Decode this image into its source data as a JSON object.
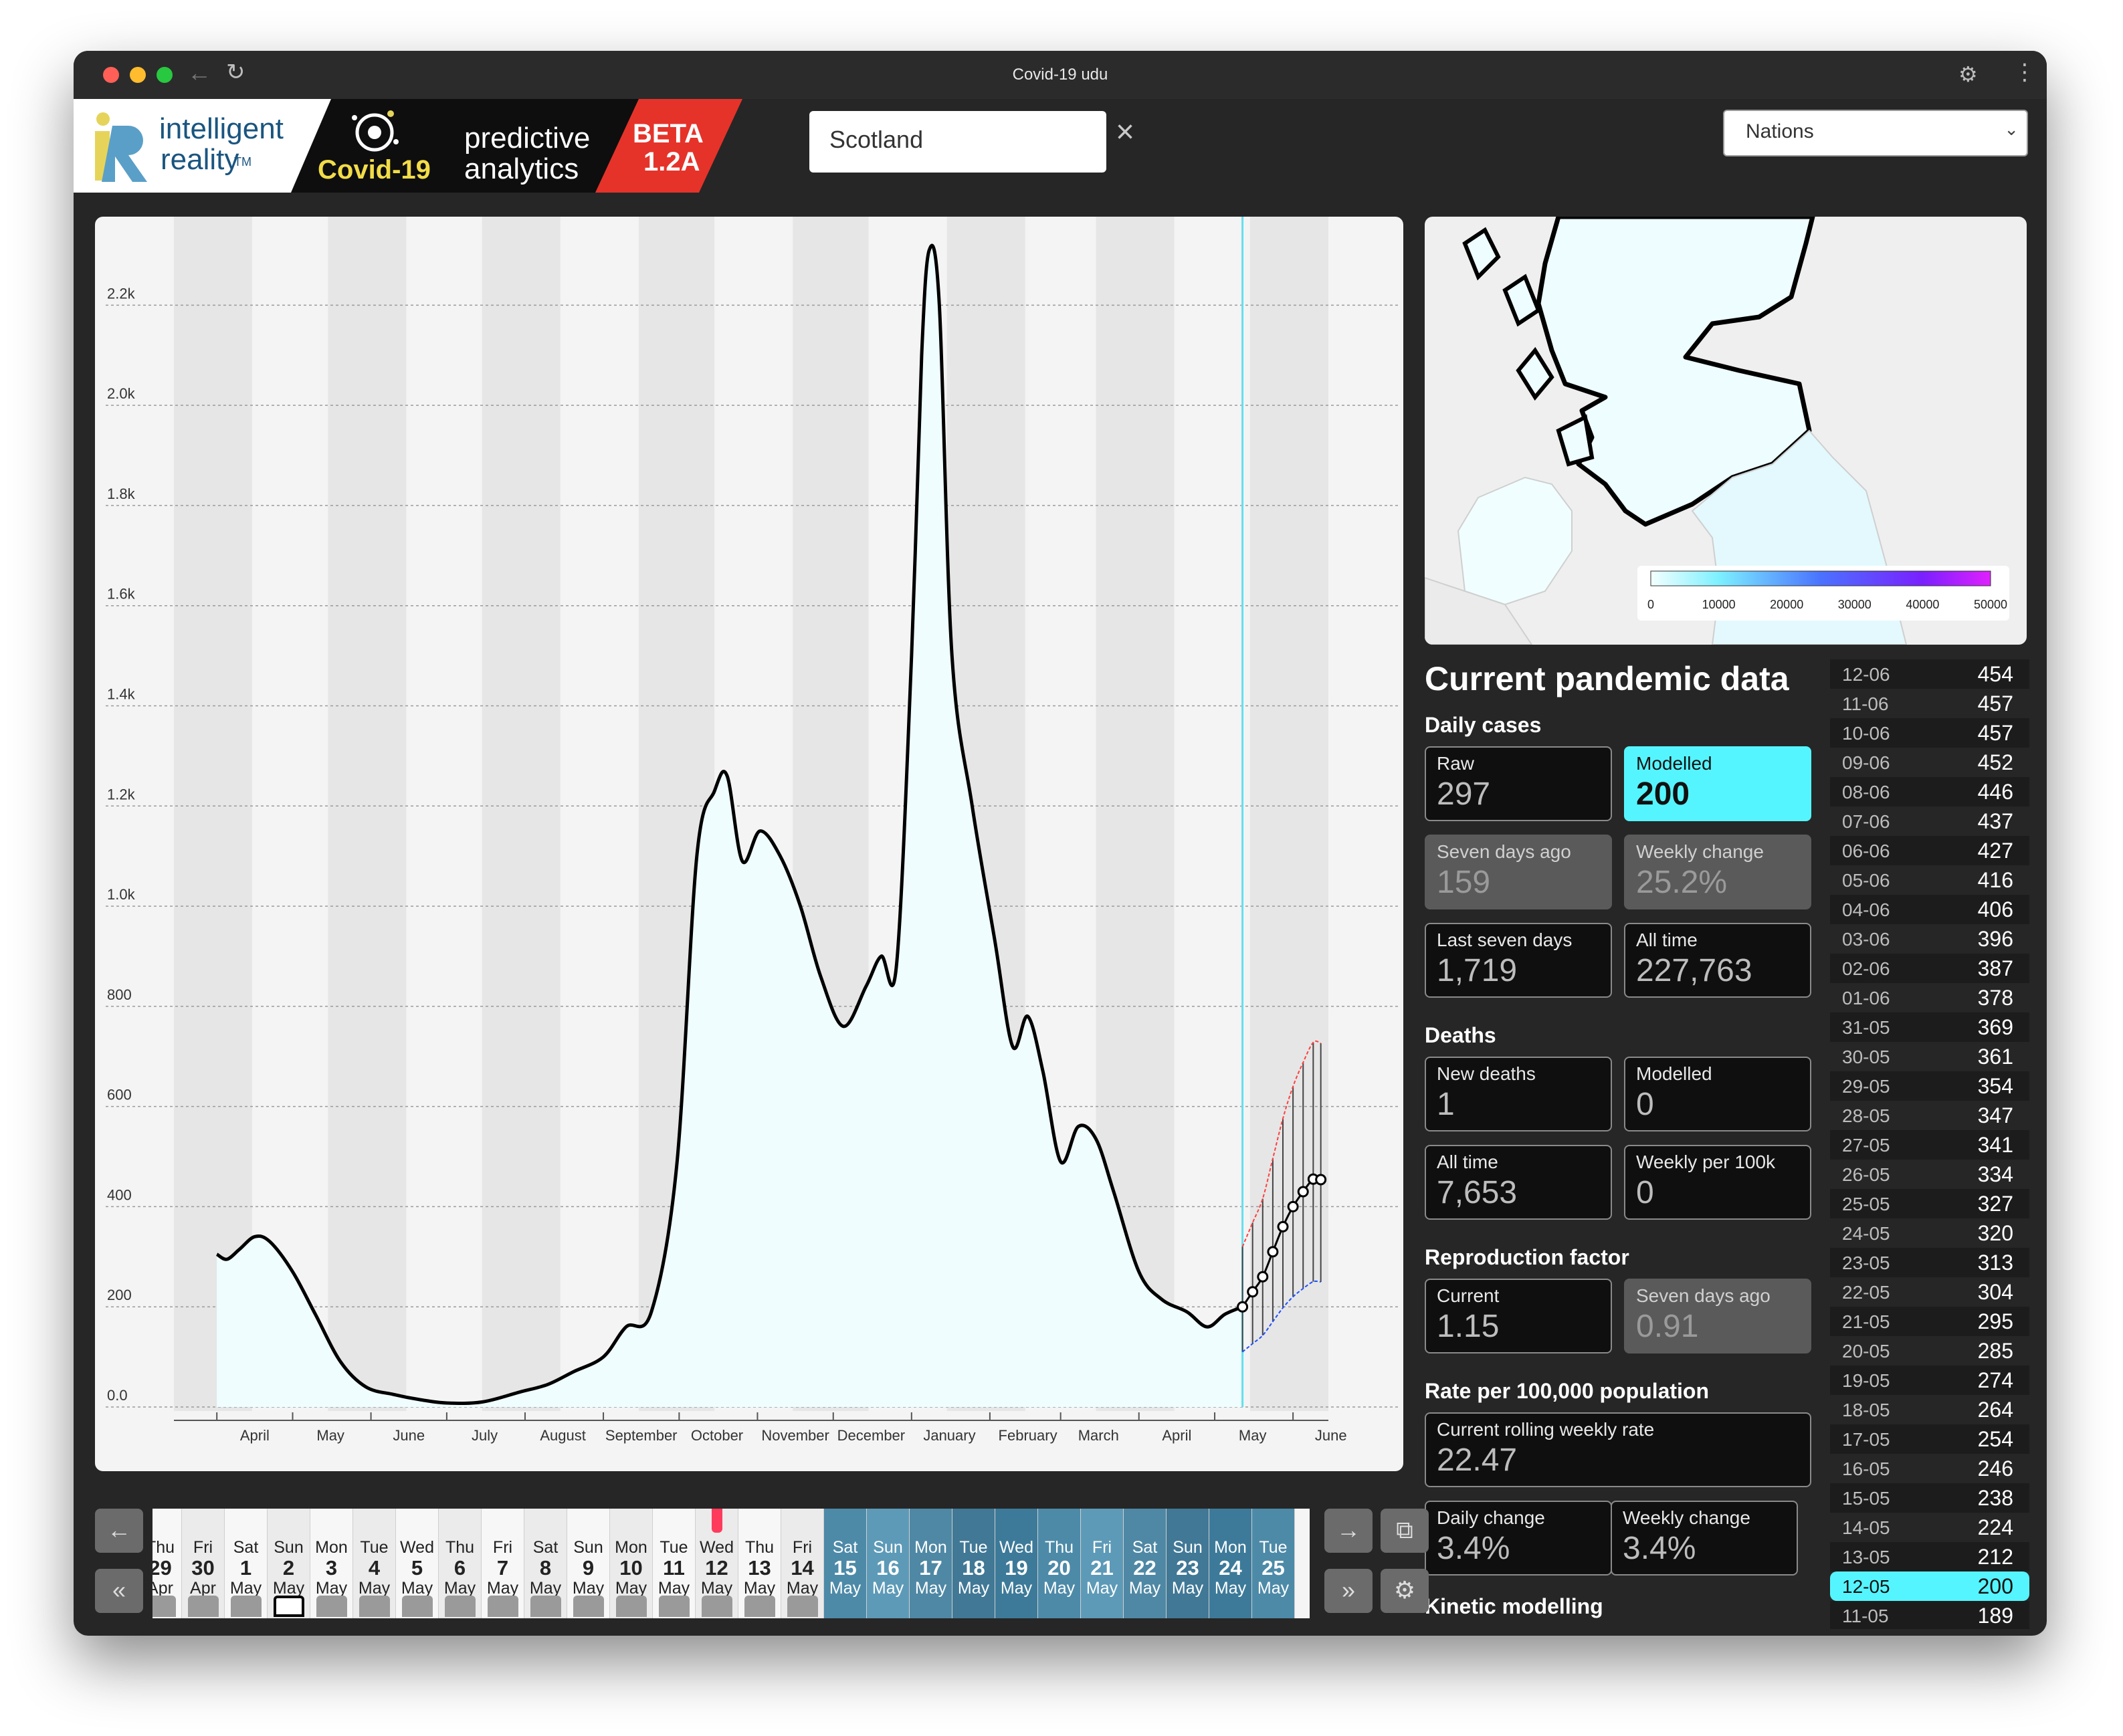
{
  "window": {
    "title": "Covid-19 udu"
  },
  "brand": {
    "company_line1": "intelligent",
    "company_line2": "reality",
    "company_tm": "TM",
    "product": "Covid-19",
    "tag_line1": "predictive",
    "tag_line2": "analytics",
    "badge_line1": "BETA",
    "badge_line2": "1.2A"
  },
  "search": {
    "value": "Scotland"
  },
  "region_select": {
    "selected": "Nations"
  },
  "map": {
    "legend_ticks": [
      "0",
      "10000",
      "20000",
      "30000",
      "40000",
      "50000"
    ]
  },
  "chart_data": {
    "type": "area",
    "title": "",
    "xlabel": "",
    "ylabel": "",
    "yticks": [
      "0.0",
      "200",
      "400",
      "600",
      "800",
      "1.0k",
      "1.2k",
      "1.4k",
      "1.6k",
      "1.8k",
      "2.0k",
      "2.2k"
    ],
    "ylim": [
      0,
      2350
    ],
    "xticks": [
      "April",
      "May",
      "June",
      "July",
      "August",
      "September",
      "October",
      "November",
      "December",
      "January",
      "February",
      "March",
      "April",
      "May",
      "June"
    ],
    "xlim": [
      "2020-03-15",
      "2021-06-15"
    ],
    "series": [
      {
        "values": [
          [
            "2020-04-01",
            305
          ],
          [
            "2020-04-05",
            295
          ],
          [
            "2020-04-10",
            315
          ],
          [
            "2020-04-16",
            340
          ],
          [
            "2020-04-22",
            330
          ],
          [
            "2020-05-01",
            270
          ],
          [
            "2020-05-10",
            185
          ],
          [
            "2020-05-20",
            90
          ],
          [
            "2020-05-30",
            40
          ],
          [
            "2020-06-10",
            25
          ],
          [
            "2020-06-20",
            15
          ],
          [
            "2020-07-01",
            8
          ],
          [
            "2020-07-15",
            10
          ],
          [
            "2020-07-30",
            30
          ],
          [
            "2020-08-10",
            45
          ],
          [
            "2020-08-20",
            70
          ],
          [
            "2020-09-01",
            100
          ],
          [
            "2020-09-10",
            160
          ],
          [
            "2020-09-20",
            190
          ],
          [
            "2020-09-30",
            480
          ],
          [
            "2020-10-08",
            1100
          ],
          [
            "2020-10-15",
            1230
          ],
          [
            "2020-10-20",
            1260
          ],
          [
            "2020-10-26",
            1090
          ],
          [
            "2020-11-02",
            1150
          ],
          [
            "2020-11-10",
            1100
          ],
          [
            "2020-11-18",
            1000
          ],
          [
            "2020-11-26",
            860
          ],
          [
            "2020-12-05",
            760
          ],
          [
            "2020-12-14",
            840
          ],
          [
            "2020-12-20",
            900
          ],
          [
            "2020-12-26",
            880
          ],
          [
            "2021-01-01",
            1500
          ],
          [
            "2021-01-05",
            2100
          ],
          [
            "2021-01-08",
            2310
          ],
          [
            "2021-01-12",
            2200
          ],
          [
            "2021-01-17",
            1500
          ],
          [
            "2021-01-25",
            1200
          ],
          [
            "2021-02-03",
            930
          ],
          [
            "2021-02-10",
            720
          ],
          [
            "2021-02-16",
            780
          ],
          [
            "2021-02-22",
            670
          ],
          [
            "2021-03-01",
            490
          ],
          [
            "2021-03-08",
            560
          ],
          [
            "2021-03-15",
            535
          ],
          [
            "2021-03-22",
            430
          ],
          [
            "2021-04-01",
            270
          ],
          [
            "2021-04-10",
            215
          ],
          [
            "2021-04-20",
            190
          ],
          [
            "2021-04-28",
            160
          ],
          [
            "2021-05-05",
            185
          ],
          [
            "2021-05-12",
            200
          ]
        ]
      },
      {
        "name": "projection",
        "values": [
          [
            "2021-05-12",
            200
          ],
          [
            "2021-05-16",
            230
          ],
          [
            "2021-05-20",
            260
          ],
          [
            "2021-05-24",
            310
          ],
          [
            "2021-05-28",
            360
          ],
          [
            "2021-06-01",
            400
          ],
          [
            "2021-06-05",
            430
          ],
          [
            "2021-06-09",
            455
          ],
          [
            "2021-06-12",
            454
          ]
        ]
      }
    ],
    "grid": true,
    "today_marker": "2021-05-12",
    "colors": {
      "fill": "#effdff",
      "line": "#000000",
      "today": "#63e0ee"
    }
  },
  "panel": {
    "title": "Current pandemic data",
    "daily_cases": {
      "heading": "Daily cases",
      "raw": {
        "label": "Raw",
        "value": "297"
      },
      "modelled": {
        "label": "Modelled",
        "value": "200"
      },
      "seven_days_ago": {
        "label": "Seven days ago",
        "value": "159"
      },
      "weekly_change": {
        "label": "Weekly change",
        "value": "25.2%"
      },
      "last_seven_days": {
        "label": "Last seven days",
        "value": "1,719"
      },
      "all_time": {
        "label": "All time",
        "value": "227,763"
      }
    },
    "deaths": {
      "heading": "Deaths",
      "new_deaths": {
        "label": "New deaths",
        "value": "1"
      },
      "modelled": {
        "label": "Modelled",
        "value": "0"
      },
      "all_time": {
        "label": "All time",
        "value": "7,653"
      },
      "weekly_per_100k": {
        "label": "Weekly per 100k",
        "value": "0"
      }
    },
    "reproduction": {
      "heading": "Reproduction factor",
      "current": {
        "label": "Current",
        "value": "1.15"
      },
      "seven_days_ago": {
        "label": "Seven days ago",
        "value": "0.91"
      }
    },
    "rate": {
      "heading": "Rate per 100,000 population",
      "rolling": {
        "label": "Current rolling weekly rate",
        "value": "22.47"
      },
      "daily_change": {
        "label": "Daily change",
        "value": "3.4%"
      },
      "weekly_change": {
        "label": "Weekly change",
        "value": "3.4%"
      }
    },
    "kinetic": {
      "heading": "Kinetic modelling"
    }
  },
  "daily_list": [
    {
      "date": "12-06",
      "value": "454"
    },
    {
      "date": "11-06",
      "value": "457"
    },
    {
      "date": "10-06",
      "value": "457"
    },
    {
      "date": "09-06",
      "value": "452"
    },
    {
      "date": "08-06",
      "value": "446"
    },
    {
      "date": "07-06",
      "value": "437"
    },
    {
      "date": "06-06",
      "value": "427"
    },
    {
      "date": "05-06",
      "value": "416"
    },
    {
      "date": "04-06",
      "value": "406"
    },
    {
      "date": "03-06",
      "value": "396"
    },
    {
      "date": "02-06",
      "value": "387"
    },
    {
      "date": "01-06",
      "value": "378"
    },
    {
      "date": "31-05",
      "value": "369"
    },
    {
      "date": "30-05",
      "value": "361"
    },
    {
      "date": "29-05",
      "value": "354"
    },
    {
      "date": "28-05",
      "value": "347"
    },
    {
      "date": "27-05",
      "value": "341"
    },
    {
      "date": "26-05",
      "value": "334"
    },
    {
      "date": "25-05",
      "value": "327"
    },
    {
      "date": "24-05",
      "value": "320"
    },
    {
      "date": "23-05",
      "value": "313"
    },
    {
      "date": "22-05",
      "value": "304"
    },
    {
      "date": "21-05",
      "value": "295"
    },
    {
      "date": "20-05",
      "value": "285"
    },
    {
      "date": "19-05",
      "value": "274"
    },
    {
      "date": "18-05",
      "value": "264"
    },
    {
      "date": "17-05",
      "value": "254"
    },
    {
      "date": "16-05",
      "value": "246"
    },
    {
      "date": "15-05",
      "value": "238"
    },
    {
      "date": "14-05",
      "value": "224"
    },
    {
      "date": "13-05",
      "value": "212"
    },
    {
      "date": "12-05",
      "value": "200"
    },
    {
      "date": "11-05",
      "value": "189"
    }
  ],
  "daily_list_selected": "12-05",
  "timeline": [
    {
      "wd": "Thu",
      "dn": "29",
      "mo": "Apr"
    },
    {
      "wd": "Fri",
      "dn": "30",
      "mo": "Apr"
    },
    {
      "wd": "Sat",
      "dn": "1",
      "mo": "May"
    },
    {
      "wd": "Sun",
      "dn": "2",
      "mo": "May"
    },
    {
      "wd": "Mon",
      "dn": "3",
      "mo": "May"
    },
    {
      "wd": "Tue",
      "dn": "4",
      "mo": "May"
    },
    {
      "wd": "Wed",
      "dn": "5",
      "mo": "May"
    },
    {
      "wd": "Thu",
      "dn": "6",
      "mo": "May"
    },
    {
      "wd": "Fri",
      "dn": "7",
      "mo": "May"
    },
    {
      "wd": "Sat",
      "dn": "8",
      "mo": "May"
    },
    {
      "wd": "Sun",
      "dn": "9",
      "mo": "May"
    },
    {
      "wd": "Mon",
      "dn": "10",
      "mo": "May"
    },
    {
      "wd": "Tue",
      "dn": "11",
      "mo": "May"
    },
    {
      "wd": "Wed",
      "dn": "12",
      "mo": "May"
    },
    {
      "wd": "Thu",
      "dn": "13",
      "mo": "May"
    },
    {
      "wd": "Fri",
      "dn": "14",
      "mo": "May"
    },
    {
      "wd": "Sat",
      "dn": "15",
      "mo": "May"
    },
    {
      "wd": "Sun",
      "dn": "16",
      "mo": "May"
    },
    {
      "wd": "Mon",
      "dn": "17",
      "mo": "May"
    },
    {
      "wd": "Tue",
      "dn": "18",
      "mo": "May"
    },
    {
      "wd": "Wed",
      "dn": "19",
      "mo": "May"
    },
    {
      "wd": "Thu",
      "dn": "20",
      "mo": "May"
    },
    {
      "wd": "Fri",
      "dn": "21",
      "mo": "May"
    },
    {
      "wd": "Sat",
      "dn": "22",
      "mo": "May"
    },
    {
      "wd": "Sun",
      "dn": "23",
      "mo": "May"
    },
    {
      "wd": "Mon",
      "dn": "24",
      "mo": "May"
    },
    {
      "wd": "Tue",
      "dn": "25",
      "mo": "May"
    }
  ],
  "timeline_today": "12",
  "icons": {
    "back": "arrow-left-icon",
    "reload": "reload-icon",
    "extension": "puzzle-icon",
    "menu": "kebab-menu-icon",
    "clear": "close-icon",
    "prev": "arrow-left-icon",
    "first": "double-arrow-left-icon",
    "next": "arrow-right-icon",
    "last": "double-arrow-right-icon",
    "share": "share-icon",
    "settings": "gear-icon"
  }
}
